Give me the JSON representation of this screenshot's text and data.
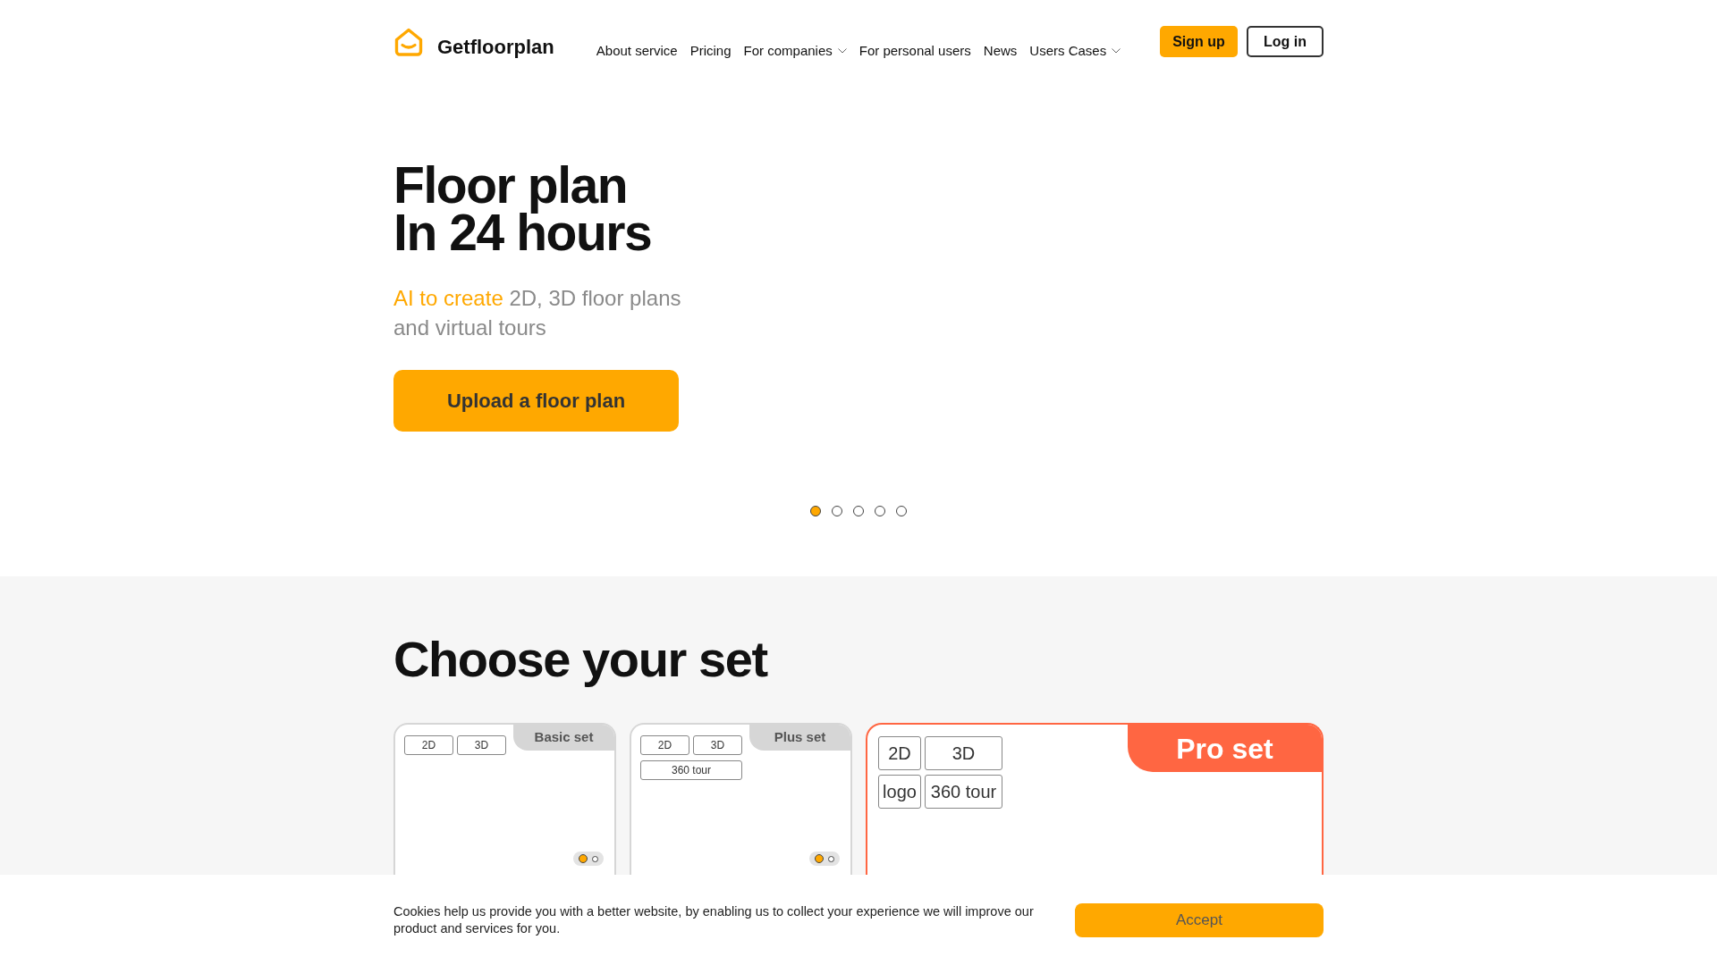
{
  "header": {
    "logo_text": "Getfloorplan",
    "nav": [
      {
        "label": "About service",
        "dropdown": false
      },
      {
        "label": "Pricing",
        "dropdown": false
      },
      {
        "label": "For companies",
        "dropdown": true
      },
      {
        "label": "For personal users",
        "dropdown": false
      },
      {
        "label": "News",
        "dropdown": false
      },
      {
        "label": "Users Cases",
        "dropdown": true
      }
    ],
    "buttons": [
      {
        "label": "Sign up",
        "kind": "primary"
      },
      {
        "label": "Log in",
        "kind": "outline"
      }
    ]
  },
  "hero": {
    "title_lines": [
      "Floor plan",
      "In 24 hours"
    ],
    "subtitle": {
      "highlight": "AI to create",
      "text": "2D, 3D floor plans and virtual tours"
    },
    "cta": "Upload a floor plan",
    "carousel_dots": [
      {
        "selected": true
      },
      {
        "selected": false
      },
      {
        "selected": false
      },
      {
        "selected": false
      },
      {
        "selected": false
      }
    ]
  },
  "sets": {
    "title": "Choose your set",
    "cards": [
      {
        "kind": "standard",
        "name": "Basic set",
        "features": [
          "2D",
          "3D"
        ],
        "slide_dots": [
          {
            "selected": true
          },
          {
            "selected": false
          }
        ]
      },
      {
        "kind": "standard",
        "name": "Plus set",
        "features": [
          "2D",
          "3D",
          "360 tour"
        ],
        "slide_dots": [
          {
            "selected": true
          },
          {
            "selected": false
          }
        ]
      },
      {
        "kind": "featured",
        "name": "Pro set",
        "features": [
          "2D",
          "3D",
          "logo",
          "360 tour"
        ]
      }
    ]
  },
  "cookie_banner": {
    "text": "Cookies help us provide you with a better website, by enabling us to collect your experience we will improve our product and services for you.",
    "button": "Accept"
  }
}
